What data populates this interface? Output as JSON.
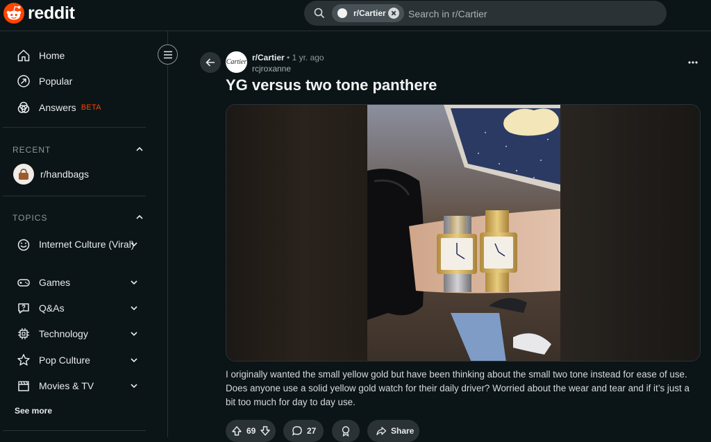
{
  "app": {
    "logo_text": "reddit"
  },
  "search": {
    "chip_label": "r/Cartier",
    "placeholder": "Search in r/Cartier"
  },
  "sidebar": {
    "nav": [
      {
        "label": "Home",
        "icon": "home-icon"
      },
      {
        "label": "Popular",
        "icon": "popular-icon"
      },
      {
        "label": "Answers",
        "icon": "answers-icon",
        "badge": "BETA"
      }
    ],
    "recent": {
      "heading": "RECENT",
      "items": [
        {
          "label": "r/handbags",
          "icon": "handbag-avatar"
        }
      ]
    },
    "topics": {
      "heading": "TOPICS",
      "items": [
        {
          "label": "Internet Culture (Viral)",
          "icon": "smiley-icon"
        },
        {
          "label": "Games",
          "icon": "gamepad-icon"
        },
        {
          "label": "Q&As",
          "icon": "question-icon"
        },
        {
          "label": "Technology",
          "icon": "chip-icon"
        },
        {
          "label": "Pop Culture",
          "icon": "star-icon"
        },
        {
          "label": "Movies & TV",
          "icon": "clapper-icon"
        }
      ],
      "see_more": "See more"
    }
  },
  "post": {
    "subreddit": "r/Cartier",
    "subreddit_avatar_text": "Cartier",
    "separator": "•",
    "age": "1 yr. ago",
    "author": "rcjroxanne",
    "title": "YG versus two tone panthere",
    "body": "I originally wanted the small yellow gold but have been thinking about the small two tone instead for ease of use. Does anyone use a solid yellow gold watch for their daily driver? Worried about the wear and tear and if it’s just a bit too much for day to day use.",
    "votes": "69",
    "comments": "27",
    "share_label": "Share"
  },
  "colors": {
    "accent": "#ff4500",
    "background": "#0b1416",
    "surface": "#2a3236"
  }
}
